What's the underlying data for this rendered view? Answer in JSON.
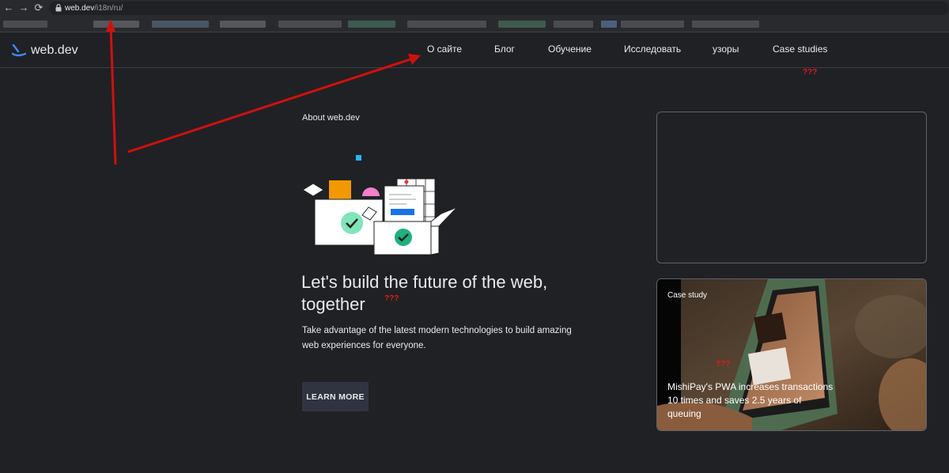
{
  "browser": {
    "url_host": "web.dev",
    "url_path": "/i18n/ru/",
    "nav": {
      "back": "←",
      "forward": "→",
      "reload": "⟳"
    }
  },
  "site": {
    "logo_text": "web.dev",
    "nav": [
      "О сайте",
      "Блог",
      "Обучение",
      "Исследовать",
      "узоры",
      "Case studies"
    ]
  },
  "hero": {
    "eyebrow": "About web.dev",
    "title": "Let's build the future of the web, together",
    "description": "Take advantage of the latest modern technologies to build amazing web experiences for everyone.",
    "button_label": "LEARN MORE"
  },
  "case_card": {
    "label": "Case study",
    "title": "MishiPay's PWA increases transactions 10 times and saves 2.5 years of queuing"
  },
  "annotations": {
    "question_marks": [
      "???",
      "???",
      "???"
    ]
  },
  "colors": {
    "page_bg": "#202124",
    "annotation_red": "#e21b1b",
    "logo_blue": "#4285f4"
  }
}
